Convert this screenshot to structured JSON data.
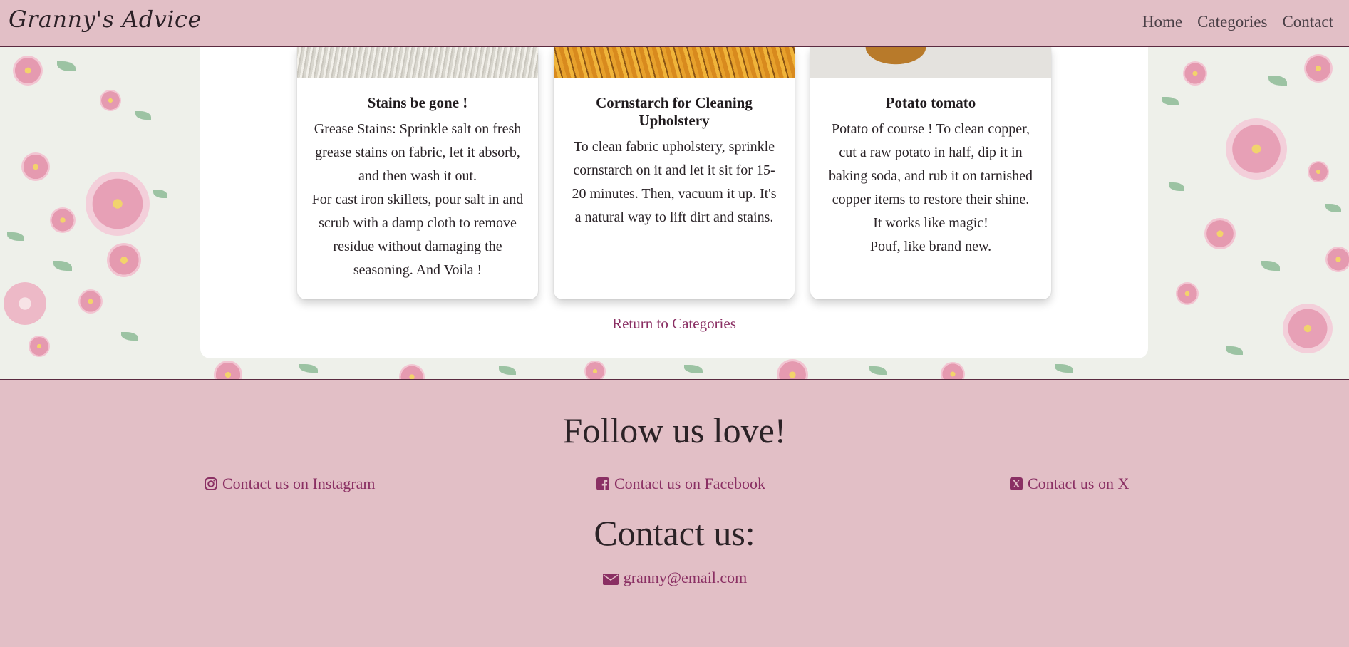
{
  "navbar": {
    "brand": "Granny's Advice",
    "links": [
      "Home",
      "Categories",
      "Contact"
    ]
  },
  "cards": [
    {
      "title": "Stains be gone !",
      "lines": [
        "Grease Stains: Sprinkle salt on fresh",
        "grease stains on fabric, let it absorb,",
        "and then wash it out.",
        "For cast iron skillets, pour salt in and",
        "scrub with a damp cloth to remove",
        "residue without damaging the",
        "seasoning. And Voila !"
      ]
    },
    {
      "title": "Cornstarch for Cleaning Upholstery",
      "lines": [
        "To clean fabric upholstery, sprinkle",
        "cornstarch on it and let it sit for 15-",
        "20 minutes. Then, vacuum it up. It's",
        "a natural way to lift dirt and stains."
      ]
    },
    {
      "title": "Potato tomato",
      "lines": [
        "Potato of course ! To clean copper,",
        "cut a raw potato in half, dip it in",
        "baking soda, and rub it on tarnished",
        "copper items to restore their shine.",
        "It works like magic!",
        "Pouf, like brand new."
      ]
    }
  ],
  "return_link": "Return to Categories",
  "footer": {
    "follow_title": "Follow us love!",
    "socials": [
      {
        "icon": "instagram-icon",
        "label": "Contact us on Instagram"
      },
      {
        "icon": "facebook-icon",
        "label": "Contact us on Facebook"
      },
      {
        "icon": "x-icon",
        "label": "Contact us on X"
      }
    ],
    "contact_title": "Contact us:",
    "email": "granny@email.com",
    "email_icon": "envelope-icon"
  },
  "colors": {
    "nav_bg": "#e2bfc6",
    "link": "#8a2f63",
    "panel": "#ffffff"
  }
}
